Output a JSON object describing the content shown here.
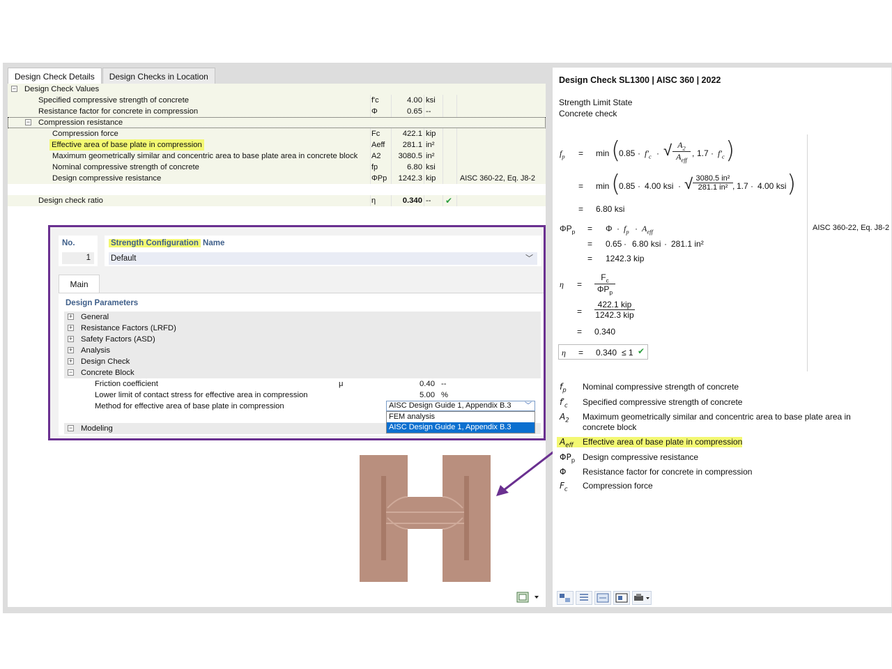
{
  "left": {
    "tabs": [
      "Design Check Details",
      "Design Checks in Location"
    ],
    "root_label": "Design Check Values",
    "rows": [
      {
        "label": "Specified compressive strength of concrete",
        "symbol": "f'c",
        "value": "4.00",
        "unit": "ksi"
      },
      {
        "label": "Resistance factor for concrete in compression",
        "symbol": "Φ",
        "value": "0.65",
        "unit": "--"
      }
    ],
    "group_label": "Compression resistance",
    "group_rows": [
      {
        "label": "Compression force",
        "symbol": "Fc",
        "value": "422.1",
        "unit": "kip"
      },
      {
        "label": "Effective area of base plate in compression",
        "symbol": "Aeff",
        "value": "281.1",
        "unit": "in²"
      },
      {
        "label": "Maximum geometrically similar and concentric area to base plate area in concrete block",
        "symbol": "A2",
        "value": "3080.5",
        "unit": "in²"
      },
      {
        "label": "Nominal compressive strength of concrete",
        "symbol": "fp",
        "value": "6.80",
        "unit": "ksi"
      },
      {
        "label": "Design compressive resistance",
        "symbol": "ΦPp",
        "value": "1242.3",
        "unit": "kip",
        "ref": "AISC 360-22, Eq. J8-2"
      }
    ],
    "ratio": {
      "label": "Design check ratio",
      "symbol": "η",
      "value": "0.340",
      "unit": "--"
    }
  },
  "config": {
    "no_label": "No.",
    "no_value": "1",
    "name_label_highlight": "Strength Configuration",
    "name_label_rest": " Name",
    "name_value": "Default",
    "tab": "Main",
    "params_title": "Design Parameters",
    "groups": [
      "General",
      "Resistance Factors (LRFD)",
      "Safety Factors (ASD)",
      "Analysis",
      "Design Check",
      "Concrete Block"
    ],
    "concrete_rows": [
      {
        "label": "Friction coefficient",
        "symbol": "μ",
        "value": "0.40",
        "unit": "--"
      },
      {
        "label": "Lower limit of contact stress for effective area in compression",
        "symbol": "",
        "value": "5.00",
        "unit": "%"
      },
      {
        "label": "Method for effective area of base plate in compression",
        "symbol": "",
        "value": "",
        "unit": ""
      }
    ],
    "dropdown_value": "AISC Design Guide 1, Appendix B.3",
    "dropdown_options": [
      "FEM analysis",
      "AISC Design Guide 1, Appendix B.3"
    ],
    "last_group": "Modeling"
  },
  "right": {
    "title": "Design Check SL1300 | AISC 360 | 2022",
    "subtitle1": "Strength Limit State",
    "subtitle2": "Concrete check",
    "eq": {
      "min": "min",
      "c085": "0.85",
      "c17": "1.7",
      "fc_val": "4.00 ksi",
      "a2_val": "3080.5 in²",
      "aeff_val": "281.1 in²",
      "fp_result": "6.80 ksi",
      "phi_val": "0.65",
      "fp_val": "6.80 ksi",
      "aeff_val2": "281.1 in²",
      "pp_result": "1242.3 kip",
      "pp_ref": "AISC 360-22, Eq. J8-2",
      "fc_force": "422.1 kip",
      "pp_force": "1242.3 kip",
      "eta_result": "0.340",
      "box_value": "0.340",
      "box_cond": "≤ 1"
    },
    "legend": [
      {
        "sym": "fp",
        "desc": "Nominal compressive strength of concrete"
      },
      {
        "sym": "f'c",
        "desc": "Specified compressive strength of concrete"
      },
      {
        "sym": "A2",
        "desc": "Maximum geometrically similar and concentric area to base plate area in concrete block"
      },
      {
        "sym": "Aeff",
        "desc": "Effective area of base plate in compression"
      },
      {
        "sym": "ΦPp",
        "desc": "Design compressive resistance"
      },
      {
        "sym": "Φ",
        "desc": "Resistance factor for concrete in compression"
      },
      {
        "sym": "Fc",
        "desc": "Compression force"
      }
    ]
  },
  "colors": {
    "highlight": "#f3f872",
    "frame": "#6a3090",
    "steel": "#b98f7e",
    "check": "#2a9d3c"
  }
}
